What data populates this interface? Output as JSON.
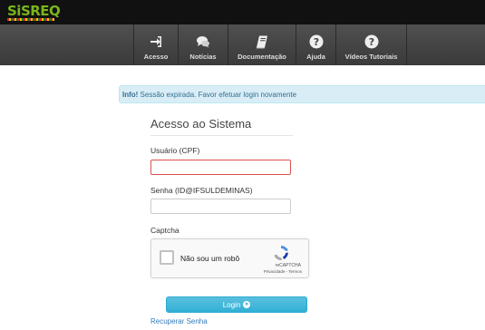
{
  "brand": {
    "logo_text": "SiSREQ"
  },
  "nav": {
    "items": [
      {
        "label": "Acesso",
        "icon": "sign-in-icon"
      },
      {
        "label": "Notícias",
        "icon": "comments-icon"
      },
      {
        "label": "Documentação",
        "icon": "book-icon"
      },
      {
        "label": "Ajuda",
        "icon": "help-icon"
      },
      {
        "label": "Vídeos Tutoriais",
        "icon": "help-icon"
      }
    ]
  },
  "alert": {
    "prefix": "Info!",
    "message": " Sessão expirada. Favor efetuar login novamente"
  },
  "login_form": {
    "title": "Acesso ao Sistema",
    "username_label": "Usuário (CPF)",
    "username_value": "",
    "password_label": "Senha (ID@IFSULDEMINAS)",
    "password_value": "",
    "captcha_label": "Captcha",
    "captcha": {
      "checkbox_text": "Não sou um robô",
      "brand": "reCAPTCHA",
      "links": "Privacidade - Termos"
    },
    "login_button": "Login",
    "recover_link": "Recuperar Senha"
  },
  "colors": {
    "topbar": "#111111",
    "navbar": "#444444",
    "alert_bg": "#d9edf7",
    "alert_text": "#31708f",
    "button": "#31b0d5",
    "input_error": "#d9534f",
    "link": "#337ab7"
  }
}
